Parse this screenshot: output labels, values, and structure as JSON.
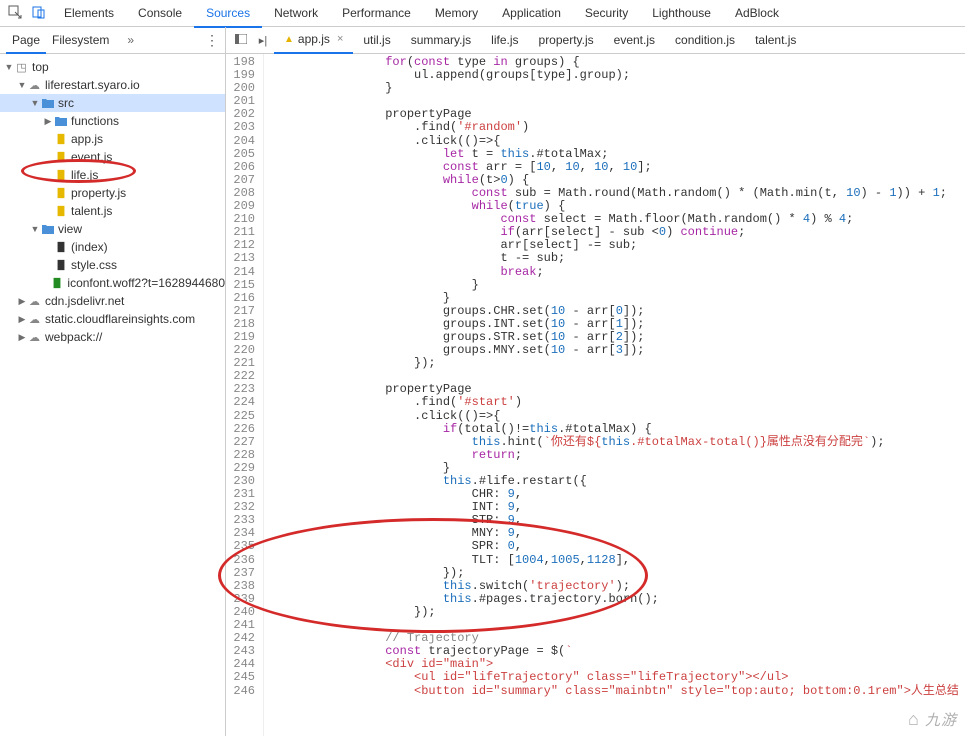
{
  "panels": [
    "Elements",
    "Console",
    "Sources",
    "Network",
    "Performance",
    "Memory",
    "Application",
    "Security",
    "Lighthouse",
    "AdBlock"
  ],
  "activePanel": "Sources",
  "subTabs": [
    "Page",
    "Filesystem"
  ],
  "activeSubTab": "Page",
  "tree": {
    "root": "top",
    "items": [
      {
        "depth": 0,
        "arrow": "down",
        "icon": "box",
        "label": "top",
        "sel": false
      },
      {
        "depth": 1,
        "arrow": "down",
        "icon": "cloud",
        "label": "liferestart.syaro.io",
        "sel": false
      },
      {
        "depth": 2,
        "arrow": "down",
        "icon": "folder-blue",
        "label": "src",
        "sel": true
      },
      {
        "depth": 3,
        "arrow": "right",
        "icon": "folder-blue",
        "label": "functions",
        "sel": false
      },
      {
        "depth": 3,
        "arrow": "",
        "icon": "file-yellow",
        "label": "app.js",
        "sel": false
      },
      {
        "depth": 3,
        "arrow": "",
        "icon": "file-yellow",
        "label": "event.js",
        "sel": false
      },
      {
        "depth": 3,
        "arrow": "",
        "icon": "file-yellow",
        "label": "life.js",
        "sel": false
      },
      {
        "depth": 3,
        "arrow": "",
        "icon": "file-yellow",
        "label": "property.js",
        "sel": false
      },
      {
        "depth": 3,
        "arrow": "",
        "icon": "file-yellow",
        "label": "talent.js",
        "sel": false
      },
      {
        "depth": 2,
        "arrow": "down",
        "icon": "folder-blue",
        "label": "view",
        "sel": false
      },
      {
        "depth": 3,
        "arrow": "",
        "icon": "file-dark",
        "label": "(index)",
        "sel": false
      },
      {
        "depth": 3,
        "arrow": "",
        "icon": "file-dark",
        "label": "style.css",
        "sel": false
      },
      {
        "depth": 3,
        "arrow": "",
        "icon": "file-green",
        "label": "iconfont.woff2?t=1628944680",
        "sel": false
      },
      {
        "depth": 1,
        "arrow": "right",
        "icon": "cloud",
        "label": "cdn.jsdelivr.net",
        "sel": false
      },
      {
        "depth": 1,
        "arrow": "right",
        "icon": "cloud",
        "label": "static.cloudflareinsights.com",
        "sel": false
      },
      {
        "depth": 1,
        "arrow": "right",
        "icon": "cloud",
        "label": "webpack://",
        "sel": false
      }
    ]
  },
  "fileTabs": [
    "app.js",
    "util.js",
    "summary.js",
    "life.js",
    "property.js",
    "event.js",
    "condition.js",
    "talent.js"
  ],
  "activeFileTab": "app.js",
  "codeLines": [
    {
      "n": 198,
      "tokens": [
        [
          "",
          "                "
        ],
        [
          "kw",
          "for"
        ],
        [
          "",
          "("
        ],
        [
          "kw",
          "const"
        ],
        [
          "",
          " type "
        ],
        [
          "kw",
          "in"
        ],
        [
          "",
          " groups) {"
        ]
      ]
    },
    {
      "n": 199,
      "tokens": [
        [
          "",
          "                    ul.append(groups[type].group);"
        ]
      ]
    },
    {
      "n": 200,
      "tokens": [
        [
          "",
          "                }"
        ]
      ]
    },
    {
      "n": 201,
      "tokens": [
        [
          "",
          ""
        ]
      ]
    },
    {
      "n": 202,
      "tokens": [
        [
          "",
          "                propertyPage"
        ]
      ]
    },
    {
      "n": 203,
      "tokens": [
        [
          "",
          "                    .find("
        ],
        [
          "str",
          "'#random'"
        ],
        [
          "",
          ")"
        ]
      ]
    },
    {
      "n": 204,
      "tokens": [
        [
          "",
          "                    .click(()=>{"
        ]
      ]
    },
    {
      "n": 205,
      "tokens": [
        [
          "",
          "                        "
        ],
        [
          "kw",
          "let"
        ],
        [
          "",
          " t = "
        ],
        [
          "this",
          "this"
        ],
        [
          "",
          ".#totalMax;"
        ]
      ]
    },
    {
      "n": 206,
      "tokens": [
        [
          "",
          "                        "
        ],
        [
          "kw",
          "const"
        ],
        [
          "",
          " arr = ["
        ],
        [
          "num",
          "10"
        ],
        [
          "",
          ", "
        ],
        [
          "num",
          "10"
        ],
        [
          "",
          ", "
        ],
        [
          "num",
          "10"
        ],
        [
          "",
          ", "
        ],
        [
          "num",
          "10"
        ],
        [
          "",
          "];"
        ]
      ]
    },
    {
      "n": 207,
      "tokens": [
        [
          "",
          "                        "
        ],
        [
          "kw",
          "while"
        ],
        [
          "",
          "(t>"
        ],
        [
          "num",
          "0"
        ],
        [
          "",
          ") {"
        ]
      ]
    },
    {
      "n": 208,
      "tokens": [
        [
          "",
          "                            "
        ],
        [
          "kw",
          "const"
        ],
        [
          "",
          " sub = Math.round(Math.random() * (Math.min(t, "
        ],
        [
          "num",
          "10"
        ],
        [
          "",
          ") - "
        ],
        [
          "num",
          "1"
        ],
        [
          "",
          ")) + "
        ],
        [
          "num",
          "1"
        ],
        [
          "",
          ";"
        ]
      ]
    },
    {
      "n": 209,
      "tokens": [
        [
          "",
          "                            "
        ],
        [
          "kw",
          "while"
        ],
        [
          "",
          "("
        ],
        [
          "const",
          "true"
        ],
        [
          "",
          ") {"
        ]
      ]
    },
    {
      "n": 210,
      "tokens": [
        [
          "",
          "                                "
        ],
        [
          "kw",
          "const"
        ],
        [
          "",
          " select = Math.floor(Math.random() * "
        ],
        [
          "num",
          "4"
        ],
        [
          "",
          ") % "
        ],
        [
          "num",
          "4"
        ],
        [
          "",
          ";"
        ]
      ]
    },
    {
      "n": 211,
      "tokens": [
        [
          "",
          "                                "
        ],
        [
          "kw",
          "if"
        ],
        [
          "",
          "(arr[select] - sub <"
        ],
        [
          "num",
          "0"
        ],
        [
          "",
          ") "
        ],
        [
          "kw",
          "continue"
        ],
        [
          "",
          ";"
        ]
      ]
    },
    {
      "n": 212,
      "tokens": [
        [
          "",
          "                                arr[select] -= sub;"
        ]
      ]
    },
    {
      "n": 213,
      "tokens": [
        [
          "",
          "                                t -= sub;"
        ]
      ]
    },
    {
      "n": 214,
      "tokens": [
        [
          "",
          "                                "
        ],
        [
          "kw",
          "break"
        ],
        [
          "",
          ";"
        ]
      ]
    },
    {
      "n": 215,
      "tokens": [
        [
          "",
          "                            }"
        ]
      ]
    },
    {
      "n": 216,
      "tokens": [
        [
          "",
          "                        }"
        ]
      ]
    },
    {
      "n": 217,
      "tokens": [
        [
          "",
          "                        groups.CHR.set("
        ],
        [
          "num",
          "10"
        ],
        [
          "",
          " - arr["
        ],
        [
          "num",
          "0"
        ],
        [
          "",
          "]);"
        ]
      ]
    },
    {
      "n": 218,
      "tokens": [
        [
          "",
          "                        groups.INT.set("
        ],
        [
          "num",
          "10"
        ],
        [
          "",
          " - arr["
        ],
        [
          "num",
          "1"
        ],
        [
          "",
          "]);"
        ]
      ]
    },
    {
      "n": 219,
      "tokens": [
        [
          "",
          "                        groups.STR.set("
        ],
        [
          "num",
          "10"
        ],
        [
          "",
          " - arr["
        ],
        [
          "num",
          "2"
        ],
        [
          "",
          "]);"
        ]
      ]
    },
    {
      "n": 220,
      "tokens": [
        [
          "",
          "                        groups.MNY.set("
        ],
        [
          "num",
          "10"
        ],
        [
          "",
          " - arr["
        ],
        [
          "num",
          "3"
        ],
        [
          "",
          "]);"
        ]
      ]
    },
    {
      "n": 221,
      "tokens": [
        [
          "",
          "                    });"
        ]
      ]
    },
    {
      "n": 222,
      "tokens": [
        [
          "",
          ""
        ]
      ]
    },
    {
      "n": 223,
      "tokens": [
        [
          "",
          "                propertyPage"
        ]
      ]
    },
    {
      "n": 224,
      "tokens": [
        [
          "",
          "                    .find("
        ],
        [
          "str",
          "'#start'"
        ],
        [
          "",
          ")"
        ]
      ]
    },
    {
      "n": 225,
      "tokens": [
        [
          "",
          "                    .click(()=>{"
        ]
      ]
    },
    {
      "n": 226,
      "tokens": [
        [
          "",
          "                        "
        ],
        [
          "kw",
          "if"
        ],
        [
          "",
          "(total()!="
        ],
        [
          "this",
          "this"
        ],
        [
          "",
          ".#totalMax) {"
        ]
      ]
    },
    {
      "n": 227,
      "tokens": [
        [
          "",
          "                            "
        ],
        [
          "this",
          "this"
        ],
        [
          "",
          ".hint("
        ],
        [
          "str",
          "`你还有${"
        ],
        [
          "this",
          "this"
        ],
        [
          "str",
          ".#totalMax-total()}属性点没有分配完`"
        ],
        [
          "",
          ");"
        ]
      ]
    },
    {
      "n": 228,
      "tokens": [
        [
          "",
          "                            "
        ],
        [
          "kw",
          "return"
        ],
        [
          "",
          ";"
        ]
      ]
    },
    {
      "n": 229,
      "tokens": [
        [
          "",
          "                        }"
        ]
      ]
    },
    {
      "n": 230,
      "tokens": [
        [
          "",
          "                        "
        ],
        [
          "this",
          "this"
        ],
        [
          "",
          ".#life.restart({"
        ]
      ]
    },
    {
      "n": 231,
      "tokens": [
        [
          "",
          "                            CHR: "
        ],
        [
          "num",
          "9"
        ],
        [
          "",
          ","
        ]
      ]
    },
    {
      "n": 232,
      "tokens": [
        [
          "",
          "                            INT: "
        ],
        [
          "num",
          "9"
        ],
        [
          "",
          ","
        ]
      ]
    },
    {
      "n": 233,
      "tokens": [
        [
          "",
          "                            STR: "
        ],
        [
          "num",
          "9"
        ],
        [
          "",
          ","
        ]
      ]
    },
    {
      "n": 234,
      "tokens": [
        [
          "",
          "                            MNY: "
        ],
        [
          "num",
          "9"
        ],
        [
          "",
          ","
        ]
      ]
    },
    {
      "n": 235,
      "tokens": [
        [
          "",
          "                            SPR: "
        ],
        [
          "num",
          "0"
        ],
        [
          "",
          ","
        ]
      ]
    },
    {
      "n": 236,
      "tokens": [
        [
          "",
          "                            TLT: ["
        ],
        [
          "num",
          "1004"
        ],
        [
          "",
          ","
        ],
        [
          "num",
          "1005"
        ],
        [
          "",
          ","
        ],
        [
          "num",
          "1128"
        ],
        [
          "",
          "],"
        ]
      ]
    },
    {
      "n": 237,
      "tokens": [
        [
          "",
          "                        });"
        ]
      ]
    },
    {
      "n": 238,
      "tokens": [
        [
          "",
          "                        "
        ],
        [
          "this",
          "this"
        ],
        [
          "",
          ".switch("
        ],
        [
          "str",
          "'trajectory'"
        ],
        [
          "",
          ");"
        ]
      ]
    },
    {
      "n": 239,
      "tokens": [
        [
          "",
          "                        "
        ],
        [
          "this",
          "this"
        ],
        [
          "",
          ".#pages.trajectory.born();"
        ]
      ]
    },
    {
      "n": 240,
      "tokens": [
        [
          "",
          "                    });"
        ]
      ]
    },
    {
      "n": 241,
      "tokens": [
        [
          "",
          ""
        ]
      ]
    },
    {
      "n": 242,
      "tokens": [
        [
          "",
          "                "
        ],
        [
          "comm",
          "// Trajectory"
        ]
      ]
    },
    {
      "n": 243,
      "tokens": [
        [
          "",
          "                "
        ],
        [
          "kw",
          "const"
        ],
        [
          "",
          " trajectoryPage = $("
        ],
        [
          "str",
          "`"
        ]
      ]
    },
    {
      "n": 244,
      "tokens": [
        [
          "tag",
          "                <div id=\"main\">"
        ]
      ]
    },
    {
      "n": 245,
      "tokens": [
        [
          "tag",
          "                    <ul id=\"lifeTrajectory\" class=\"lifeTrajectory\"></ul>"
        ]
      ]
    },
    {
      "n": 246,
      "tokens": [
        [
          "tag",
          "                    <button id=\"summary\" class=\"mainbtn\" style=\"top:auto; bottom:0.1rem\">人生总结"
        ]
      ]
    }
  ],
  "watermark": "九游"
}
